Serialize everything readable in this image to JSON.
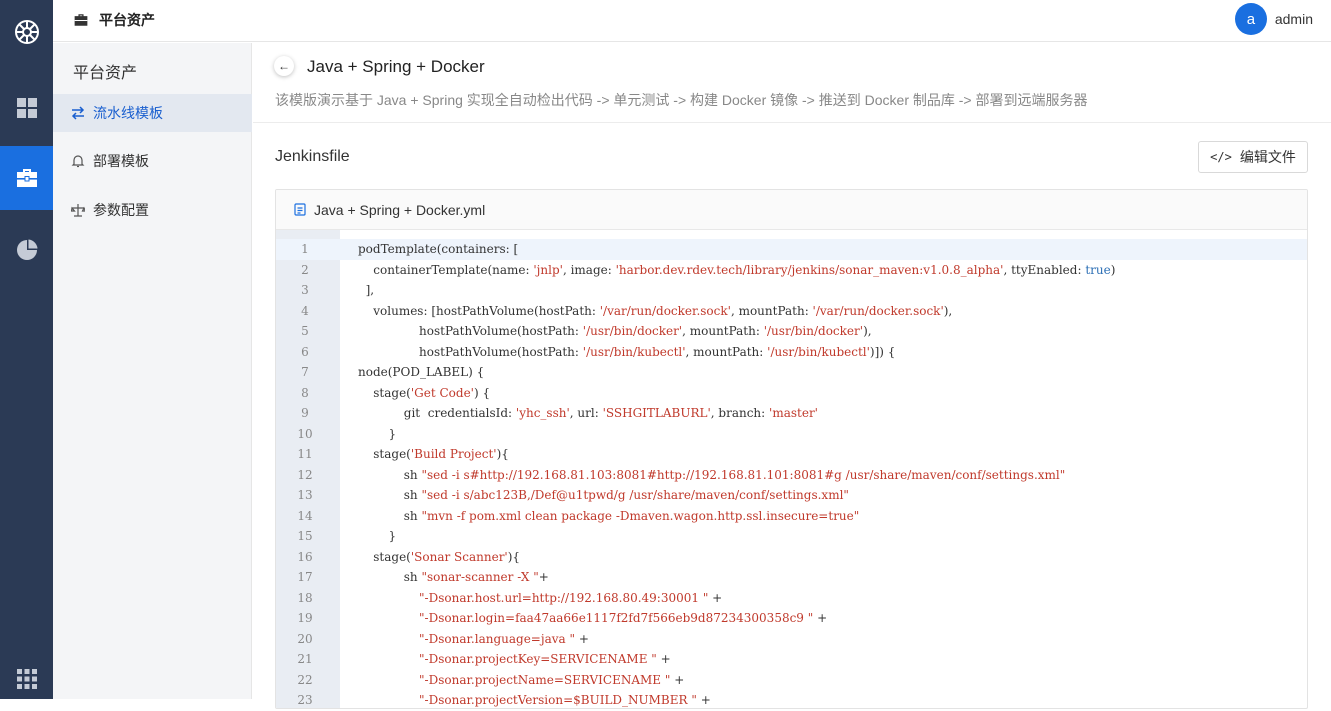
{
  "topbar": {
    "title": "平台资产",
    "user_initial": "a",
    "user_name": "admin"
  },
  "rail": {
    "items": [
      "dashboard-icon",
      "briefcase-icon",
      "pie-chart-icon",
      "apps-grid-icon"
    ],
    "active": "briefcase-icon"
  },
  "subnav": {
    "title": "平台资产",
    "items": [
      {
        "label": "流水线模板",
        "icon": "swap-icon",
        "active": true
      },
      {
        "label": "部署模板",
        "icon": "bell-icon",
        "active": false
      },
      {
        "label": "参数配置",
        "icon": "balance-icon",
        "active": false
      }
    ]
  },
  "page": {
    "title": "Java + Spring + Docker",
    "description": "该模版演示基于 Java + Spring 实现全自动检出代码 -> 单元测试 -> 构建 Docker 镜像 -> 推送到 Docker 制品库 -> 部署到远端服务器",
    "section_title": "Jenkinsfile",
    "edit_label": "编辑文件",
    "file_name": "Java + Spring + Docker.yml"
  },
  "colors": {
    "accent": "#1a6fe0",
    "rail": "#2b3a55",
    "string": "#c0392b",
    "keyword": "#2c6fb5"
  },
  "code_lines": [
    "podTemplate(containers: [",
    "    containerTemplate(name: 'jnlp', image: 'harbor.dev.rdev.tech/library/jenkins/sonar_maven:v1.0.8_alpha', ttyEnabled: true)",
    "  ],",
    "    volumes: [hostPathVolume(hostPath: '/var/run/docker.sock', mountPath: '/var/run/docker.sock'),",
    "                hostPathVolume(hostPath: '/usr/bin/docker', mountPath: '/usr/bin/docker'),",
    "                hostPathVolume(hostPath: '/usr/bin/kubectl', mountPath: '/usr/bin/kubectl')]) {",
    "node(POD_LABEL) {",
    "    stage('Get Code') {",
    "            git  credentialsId: 'yhc_ssh', url: 'SSHGITLABURL', branch: 'master'",
    "        }",
    "    stage('Build Project'){",
    "            sh \"sed -i s#http://192.168.81.103:8081#http://192.168.81.101:8081#g /usr/share/maven/conf/settings.xml\"",
    "            sh \"sed -i s/abc123B,/Def@u1tpwd/g /usr/share/maven/conf/settings.xml\"",
    "            sh \"mvn -f pom.xml clean package -Dmaven.wagon.http.ssl.insecure=true\"",
    "        }",
    "    stage('Sonar Scanner'){",
    "            sh \"sonar-scanner -X \"+",
    "                \"-Dsonar.host.url=http://192.168.80.49:30001 \" +",
    "                \"-Dsonar.login=faa47aa66e1117f2fd7f566eb9d87234300358c9 \" +",
    "                \"-Dsonar.language=java \" +",
    "                \"-Dsonar.projectKey=SERVICENAME \" +",
    "                \"-Dsonar.projectName=SERVICENAME \" +",
    "                \"-Dsonar.projectVersion=$BUILD_NUMBER \" +"
  ],
  "current_line": 1
}
